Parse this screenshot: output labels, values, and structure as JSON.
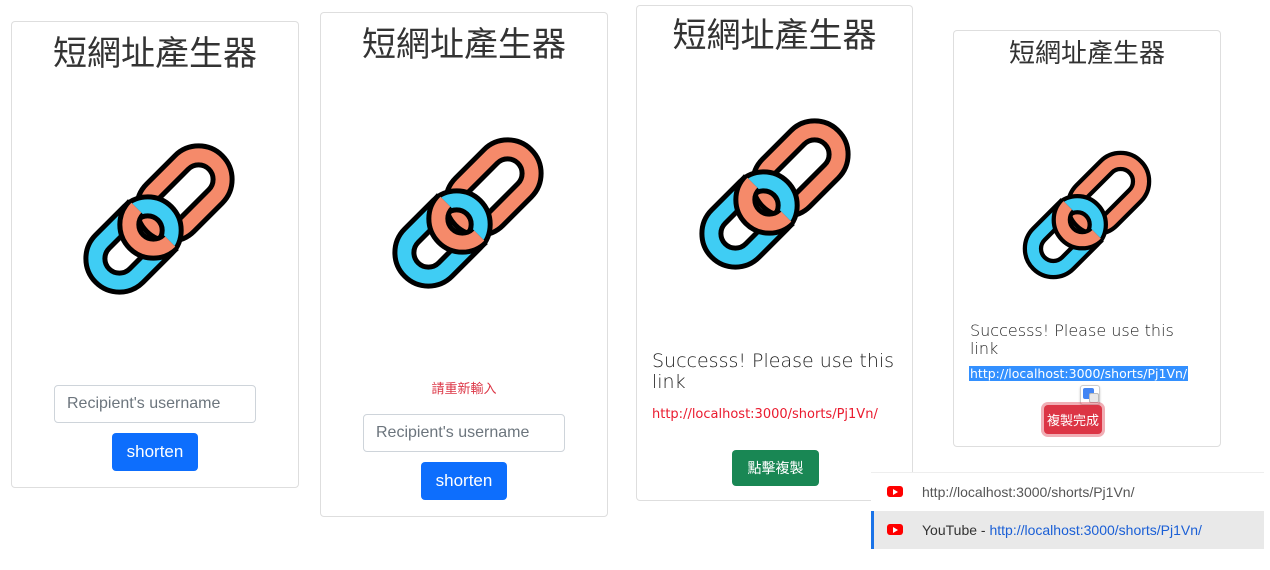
{
  "title": "短網址產生器",
  "input_placeholder": "Recipient's username",
  "shorten_label": "shorten",
  "error_message": "請重新輸入",
  "success_message": "Successs! Please use this link",
  "short_url": "http://localhost:3000/shorts/Pj1Vn/",
  "copy_button_label": "點擊複製",
  "copied_button_label": "複製完成",
  "suggestions": [
    {
      "prefix": "",
      "url": "http://localhost:3000/shorts/Pj1Vn/",
      "icon": "youtube-icon"
    },
    {
      "prefix": "YouTube - ",
      "url": "http://localhost:3000/shorts/Pj1Vn/",
      "icon": "youtube-icon"
    }
  ],
  "colors": {
    "primary": "#0d6efd",
    "success": "#198754",
    "danger": "#dc3545",
    "link_red": "#ea1a2e",
    "chain_orange": "#f58a6a",
    "chain_blue": "#3fcdf4",
    "selection": "#3390ff"
  }
}
